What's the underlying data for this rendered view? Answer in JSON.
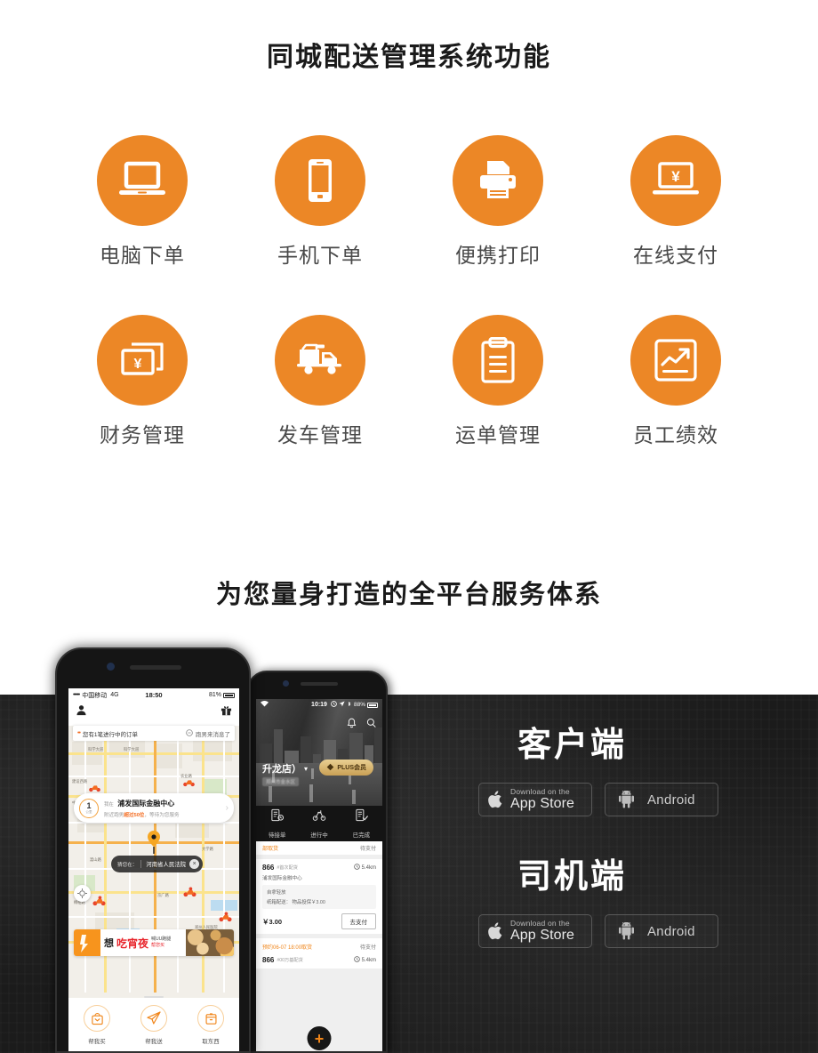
{
  "titles": {
    "features": "同城配送管理系统功能",
    "platform": "为您量身打造的全平台服务体系"
  },
  "theme": {
    "accent": "#ec8726",
    "label_color": "#4a4a4a",
    "dark_bg": "#1b1b1b"
  },
  "features": [
    {
      "icon": "laptop-icon",
      "label": "电脑下单"
    },
    {
      "icon": "smartphone-icon",
      "label": "手机下单"
    },
    {
      "icon": "printer-icon",
      "label": "便携打印"
    },
    {
      "icon": "laptop-yuan-icon",
      "label": "在线支付"
    },
    {
      "icon": "cards-yuan-icon",
      "label": "财务管理"
    },
    {
      "icon": "truck-icon",
      "label": "发车管理"
    },
    {
      "icon": "clipboard-icon",
      "label": "运单管理"
    },
    {
      "icon": "trend-chart-icon",
      "label": "员工绩效"
    }
  ],
  "platforms": [
    {
      "title": "客户端",
      "buttons": [
        {
          "icon": "apple-icon",
          "small": "Download on the",
          "big": "App Store"
        },
        {
          "icon": "android-icon",
          "label": "Android"
        }
      ]
    },
    {
      "title": "司机端",
      "buttons": [
        {
          "icon": "apple-icon",
          "small": "Download on the",
          "big": "App Store"
        },
        {
          "icon": "android-icon",
          "label": "Android"
        }
      ]
    }
  ],
  "phone_customer": {
    "status": {
      "dots": "•••••",
      "carrier": "中国移动",
      "network": "4G",
      "time": "18:50",
      "battery": "81%"
    },
    "notice": {
      "text": "您有1笔进行中的订单",
      "right": "跑男来消息了"
    },
    "card": {
      "badge_number": "1",
      "badge_unit": "公里",
      "prefix": "我在",
      "place": "浦发国际金融中心",
      "sub_pre": "附近跑男",
      "sub_em": "超过50位",
      "sub_post": "，等待为您服务"
    },
    "tip": {
      "label": "猜您在：",
      "value": "河南省人民法院"
    },
    "banner": {
      "w1": "想",
      "w2": "吃宵夜",
      "line1": "喊UU跑腿",
      "line2": "帮您买"
    },
    "actions": [
      {
        "icon": "bag-icon",
        "label": "帮我买"
      },
      {
        "icon": "plane-icon",
        "label": "帮我送"
      },
      {
        "icon": "box-icon",
        "label": "取东西"
      }
    ],
    "map_labels": [
      "科学大道",
      "科学大道",
      "郑州市",
      "中原西路",
      "建设西路",
      "农业路",
      "金水区",
      "郑州火车站",
      "河南农业大学",
      "大学路",
      "嵩山路",
      "桐柏路",
      "陇海路",
      "京广路",
      "郑州人民医院"
    ]
  },
  "phone_driver": {
    "status": {
      "time": "10:19",
      "battery": "88%"
    },
    "shop": {
      "name": "升龙店）",
      "caret": "▾",
      "sub": "郑州市金水区"
    },
    "plus_badge": "PLUS会员",
    "tabs": [
      {
        "icon": "receipt-icon",
        "label": "待接单"
      },
      {
        "icon": "scooter-icon",
        "label": "进行中"
      },
      {
        "icon": "done-icon",
        "label": "已完成"
      }
    ],
    "orders": [
      {
        "title": "866",
        "tag": "#首次配货",
        "distance": "5.4km",
        "state": "待支付",
        "address": "浦发国际金融中心",
        "line1": "自拿轻放",
        "line2": "纸箱配送：  物品投保￥3.00",
        "price": "￥3.00",
        "action": "去支付"
      },
      {
        "time": "预约06-07 18:00取货",
        "state": "待支付",
        "title": "866",
        "tag": "#00万基配货",
        "distance": "5.4km"
      }
    ],
    "top_order_state": "待支付",
    "fab": "+"
  }
}
